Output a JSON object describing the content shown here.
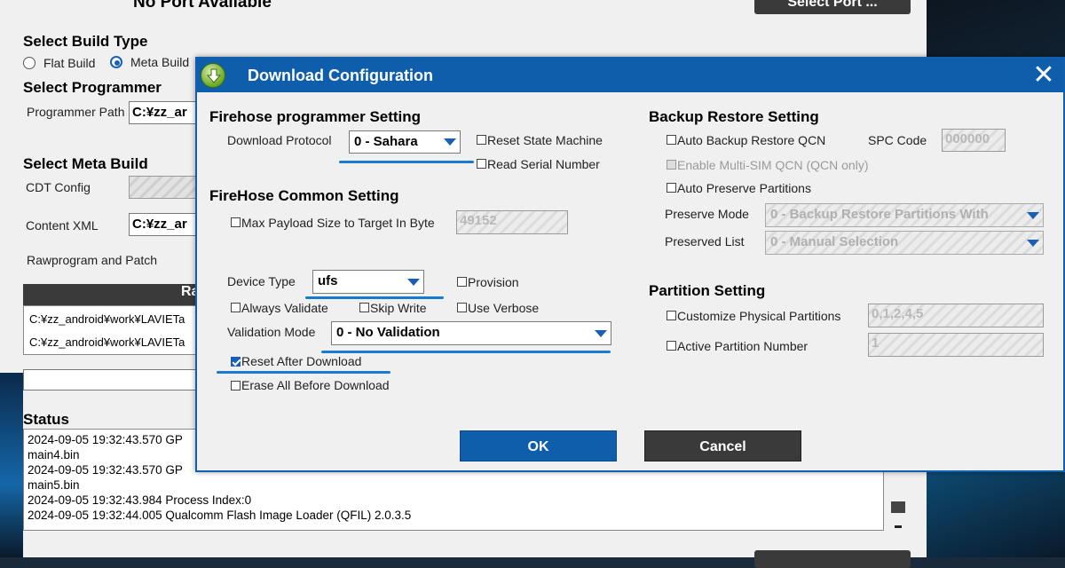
{
  "main": {
    "no_port": "No Port Available",
    "select_port_btn": "Select Port ...",
    "build_type_heading": "Select Build Type",
    "flat_build": "Flat Build",
    "meta_build": "Meta Build",
    "programmer_heading": "Select Programmer",
    "programmer_path_label": "Programmer Path",
    "programmer_path_value": "C:¥zz_ar",
    "meta_build_heading": "Select Meta Build",
    "cdt_config_label": "CDT Config",
    "content_xml_label": "Content XML",
    "content_xml_value": "C:¥zz_ar",
    "rawprogram_label": "Rawprogram and Patch",
    "table_header": "Ra",
    "table_rows": [
      "C:¥zz_android¥work¥LAVIETa",
      "C:¥zz_android¥work¥LAVIETa"
    ],
    "status_heading": "Status",
    "status_log": [
      "2024-09-05 19:32:43.570   GP",
      "main4.bin",
      "2024-09-05 19:32:43.570   GP",
      "main5.bin",
      "2024-09-05 19:32:43.984   Process Index:0",
      "2024-09-05 19:32:44.005   Qualcomm Flash Image Loader (QFIL) 2.0.3.5"
    ]
  },
  "dialog": {
    "title": "Download Configuration",
    "firehose_programmer": {
      "heading": "Firehose programmer Setting",
      "download_protocol_label": "Download Protocol",
      "download_protocol_value": "0 - Sahara",
      "reset_state_machine": "Reset State Machine",
      "read_serial_number": "Read Serial Number"
    },
    "firehose_common": {
      "heading": "FireHose Common Setting",
      "max_payload_label": "Max Payload Size to Target In Byte",
      "max_payload_value": "49152",
      "device_type_label": "Device Type",
      "device_type_value": "ufs",
      "provision": "Provision",
      "always_validate": "Always Validate",
      "skip_write": "Skip Write",
      "use_verbose": "Use Verbose",
      "validation_mode_label": "Validation Mode",
      "validation_mode_value": "0 - No Validation",
      "reset_after_download": "Reset After Download",
      "erase_all_before_download": "Erase All Before Download"
    },
    "backup_restore": {
      "heading": "Backup Restore Setting",
      "auto_backup_restore_qcn": "Auto Backup Restore QCN",
      "spc_code_label": "SPC Code",
      "spc_code_value": "000000",
      "enable_multi_sim": "Enable Multi-SIM QCN (QCN only)",
      "auto_preserve_partitions": "Auto Preserve Partitions",
      "preserve_mode_label": "Preserve Mode",
      "preserve_mode_value": "0 - Backup Restore Partitions With",
      "preserved_list_label": "Preserved List",
      "preserved_list_value": "0 - Manual Selection"
    },
    "partition": {
      "heading": "Partition Setting",
      "customize_physical_partitions": "Customize Physical Partitions",
      "customize_physical_value": "0,1,2,4,5",
      "active_partition_number": "Active Partition Number",
      "active_partition_value": "1"
    },
    "ok_label": "OK",
    "cancel_label": "Cancel"
  },
  "colors": {
    "accent": "#0e5eab",
    "annotation_underline": "#1a7ad0",
    "dark_button": "#3a3a3a"
  }
}
